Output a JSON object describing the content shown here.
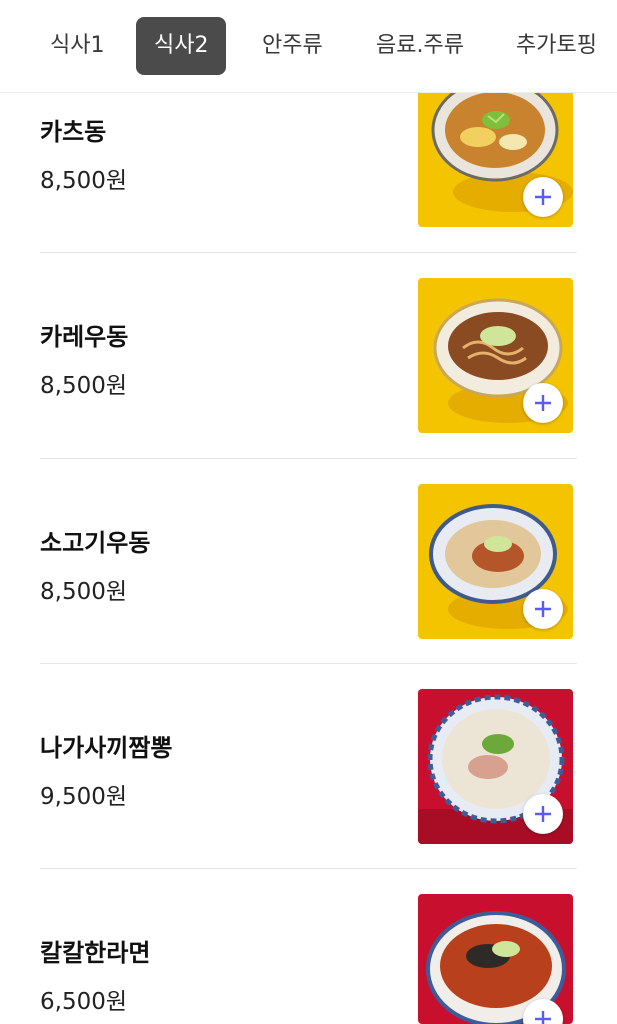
{
  "tabs": [
    {
      "label": "식사1"
    },
    {
      "label": "식사2"
    },
    {
      "label": "안주류"
    },
    {
      "label": "음료.주류"
    },
    {
      "label": "추가토핑"
    }
  ],
  "active_tab": "식사2",
  "menu_items": [
    {
      "name": "카츠동",
      "price": "8,500원",
      "image": "katsudon-photo"
    },
    {
      "name": "카레우동",
      "price": "8,500원",
      "image": "curry-udon-photo"
    },
    {
      "name": "소고기우동",
      "price": "8,500원",
      "image": "beef-udon-photo"
    },
    {
      "name": "나가사끼짬뽕",
      "price": "9,500원",
      "image": "nagasaki-champon-photo"
    },
    {
      "name": "칼칼한라면",
      "price": "6,500원",
      "image": "spicy-ramen-photo"
    }
  ],
  "icons": {
    "add": "plus-icon"
  },
  "colors": {
    "active_tab_bg": "#4b4b4b",
    "add_icon": "#5a5cf0",
    "yellow_bg": "#f5c400",
    "red_bg": "#c8102e"
  }
}
